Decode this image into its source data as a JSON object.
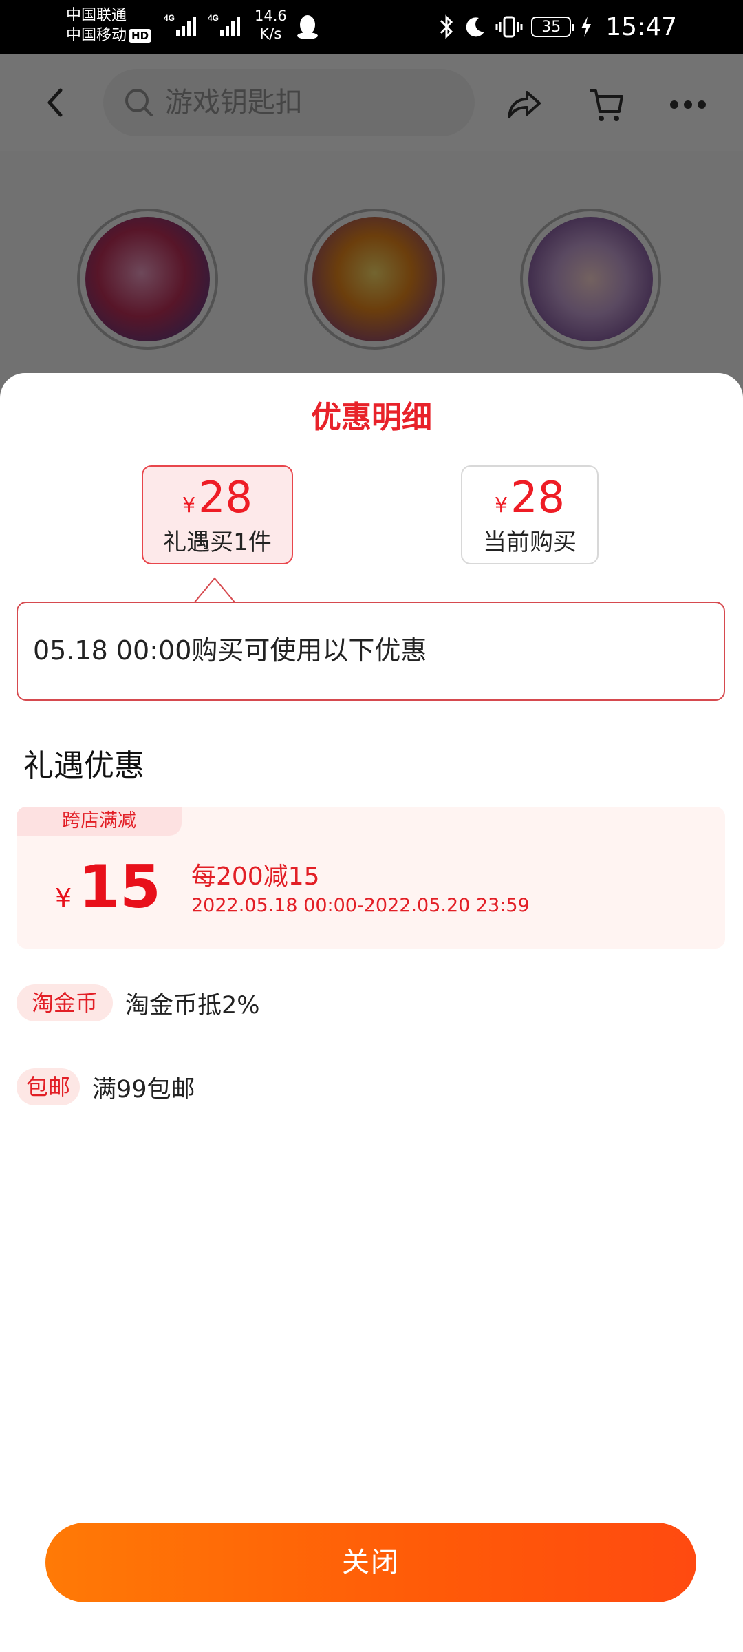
{
  "status_bar": {
    "carrier_1": "中国联通",
    "carrier_2": "中国移动",
    "hd": "HD",
    "net_1": "4G",
    "net_2": "4G",
    "speed_value": "14.6",
    "speed_unit": "K/s",
    "battery": "35",
    "time": "15:47"
  },
  "header": {
    "search_placeholder": "游戏钥匙扣"
  },
  "sheet": {
    "title": "优惠明细",
    "price_options": [
      {
        "currency": "¥",
        "amount": "28",
        "caption": "礼遇买1件",
        "selected": true
      },
      {
        "currency": "¥",
        "amount": "28",
        "caption": "当前购买",
        "selected": false
      }
    ],
    "notice": "05.18 00:00购买可使用以下优惠",
    "section_title": "礼遇优惠",
    "coupon": {
      "tag": "跨店满减",
      "currency": "¥",
      "amount": "15",
      "rule": "每200减15",
      "period": "2022.05.18 00:00-2022.05.20 23:59"
    },
    "perks": [
      {
        "tag": "淘金币",
        "text": "淘金币抵2%"
      },
      {
        "tag": "包邮",
        "text": "满99包邮"
      }
    ],
    "close_label": "关闭"
  },
  "colors": {
    "accent_red": "#e8222a",
    "button_orange": "#ff6a08"
  }
}
